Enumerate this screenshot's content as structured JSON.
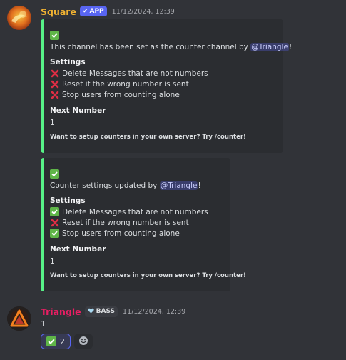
{
  "msg1": {
    "author": "Square",
    "author_color": "#f0b232",
    "badge": "APP",
    "timestamp": "11/12/2024, 12:39"
  },
  "embed1": {
    "header_emoji": "check-mark-button",
    "description_prefix": "This channel has been set as the counter channel by ",
    "mention": "@Triangle",
    "description_suffix": "!",
    "settings_title": "Settings",
    "settings": [
      {
        "icon": "cross-mark",
        "text": "Delete Messages that are not numbers"
      },
      {
        "icon": "cross-mark",
        "text": "Reset if the wrong number is sent"
      },
      {
        "icon": "cross-mark",
        "text": "Stop users from counting alone"
      }
    ],
    "next_title": "Next Number",
    "next_value": "1",
    "footer": "Want to setup counters in your own server? Try /counter!"
  },
  "embed2": {
    "header_emoji": "check-mark-button",
    "description_prefix": "Counter settings updated by ",
    "mention": "@Triangle",
    "description_suffix": "!",
    "settings_title": "Settings",
    "settings": [
      {
        "icon": "check-mark-button",
        "text": "Delete Messages that are not numbers"
      },
      {
        "icon": "cross-mark",
        "text": "Reset if the wrong number is sent"
      },
      {
        "icon": "check-mark-button",
        "text": "Stop users from counting alone"
      }
    ],
    "next_title": "Next Number",
    "next_value": "1",
    "footer": "Want to setup counters in your own server? Try /counter!"
  },
  "msg2": {
    "author": "Triangle",
    "author_color": "#e91e63",
    "badge": "BASS",
    "timestamp": "11/12/2024, 12:39",
    "content": "1"
  },
  "reactions": [
    {
      "emoji": "check-mark-button",
      "count": "2"
    },
    {
      "emoji": "add-reaction"
    }
  ]
}
